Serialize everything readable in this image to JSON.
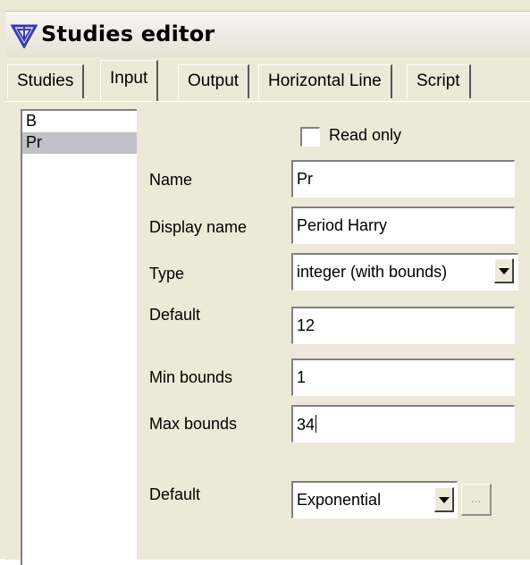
{
  "window": {
    "title": "Studies editor"
  },
  "tabs": [
    {
      "label": "Studies"
    },
    {
      "label": "Input"
    },
    {
      "label": "Output"
    },
    {
      "label": "Horizontal Line"
    },
    {
      "label": "Script"
    }
  ],
  "active_tab": "Input",
  "inputs_list": {
    "items": [
      {
        "label": "B"
      },
      {
        "label": "Pr"
      }
    ],
    "selected": "Pr"
  },
  "form": {
    "read_only_label": "Read only",
    "read_only_checked": false,
    "name_label": "Name",
    "name_value": "Pr",
    "display_name_label": "Display name",
    "display_name_value": "Period Harry",
    "type_label": "Type",
    "type_value": "integer (with bounds)",
    "default_label": "Default",
    "default_value": "12",
    "min_bounds_label": "Min bounds",
    "min_bounds_value": "1",
    "max_bounds_label": "Max bounds",
    "max_bounds_value": "34",
    "default2_label": "Default",
    "default2_value": "Exponential",
    "ellipsis_label": "..."
  },
  "colors": {
    "background": "#ece9d8",
    "selection": "#c0c0c8",
    "icon": "#3a3ab8"
  },
  "icons": {
    "title_icon": "studies-logo-icon"
  }
}
